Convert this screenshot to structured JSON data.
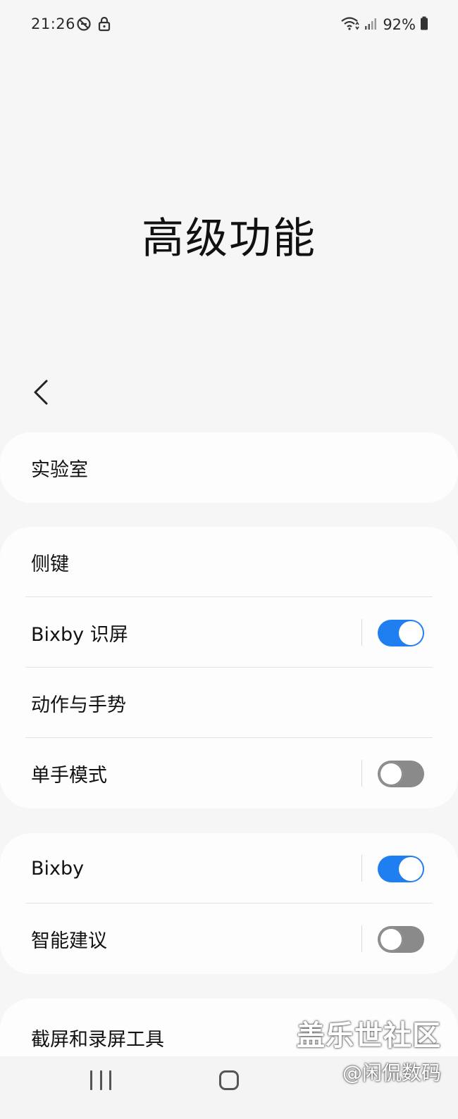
{
  "status_bar": {
    "time": "21:26",
    "icons_left": [
      "do-not-disturb-off-icon",
      "lock-icon"
    ],
    "icons_right": [
      "wifi-icon",
      "signal-icon",
      "battery-icon"
    ],
    "battery": "92%"
  },
  "header": {
    "title": "高级功能",
    "back_icon": "chevron-left-icon"
  },
  "cards": [
    {
      "rows": [
        {
          "label": "实验室"
        }
      ]
    },
    {
      "rows": [
        {
          "label": "侧键"
        },
        {
          "label": "Bixby 识屏",
          "toggle": true
        },
        {
          "label": "动作与手势"
        },
        {
          "label": "单手模式",
          "toggle": false
        }
      ]
    },
    {
      "rows": [
        {
          "label": "Bixby",
          "toggle": true
        },
        {
          "label": "智能建议",
          "toggle": false
        }
      ]
    },
    {
      "rows": [
        {
          "label": "截屏和录屏工具"
        }
      ]
    }
  ],
  "nav_bar": {
    "icons": [
      "recents-icon",
      "home-icon"
    ]
  },
  "watermark": {
    "line1": "盖乐世社区",
    "line2": "@闲侃数码"
  },
  "colors": {
    "accent": "#1f7ff0",
    "background": "#f6f6f6",
    "card": "#fdfdfd",
    "toggle_off": "#8a8a8a"
  }
}
